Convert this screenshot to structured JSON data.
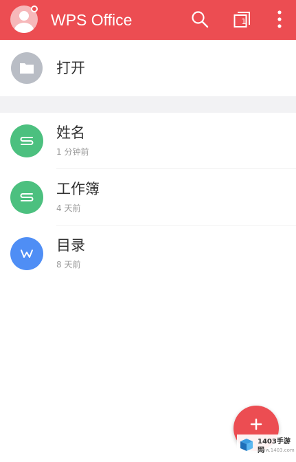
{
  "app_bar": {
    "title": "WPS Office",
    "background_color": "#ec4d52",
    "avatar_icon": "user-avatar-icon",
    "search_icon": "search-icon",
    "windows_icon": "windows-icon",
    "windows_count": "1",
    "more_icon": "more-vertical-icon"
  },
  "open_row": {
    "label": "打开",
    "icon": "folder-icon"
  },
  "recent_documents": [
    {
      "name": "姓名",
      "time": "1 分钟前",
      "type": "spreadsheet",
      "icon_letter": "S",
      "icon_color": "#4cc07f"
    },
    {
      "name": "工作簿",
      "time": "4 天前",
      "type": "spreadsheet",
      "icon_letter": "S",
      "icon_color": "#4cc07f"
    },
    {
      "name": "目录",
      "time": "8 天前",
      "type": "writer",
      "icon_letter": "W",
      "icon_color": "#4f8ef5"
    }
  ],
  "fab": {
    "icon": "plus-icon",
    "color": "#ec4d52"
  },
  "watermark": {
    "text": "1403手游网",
    "sub": "www.1403.com"
  }
}
